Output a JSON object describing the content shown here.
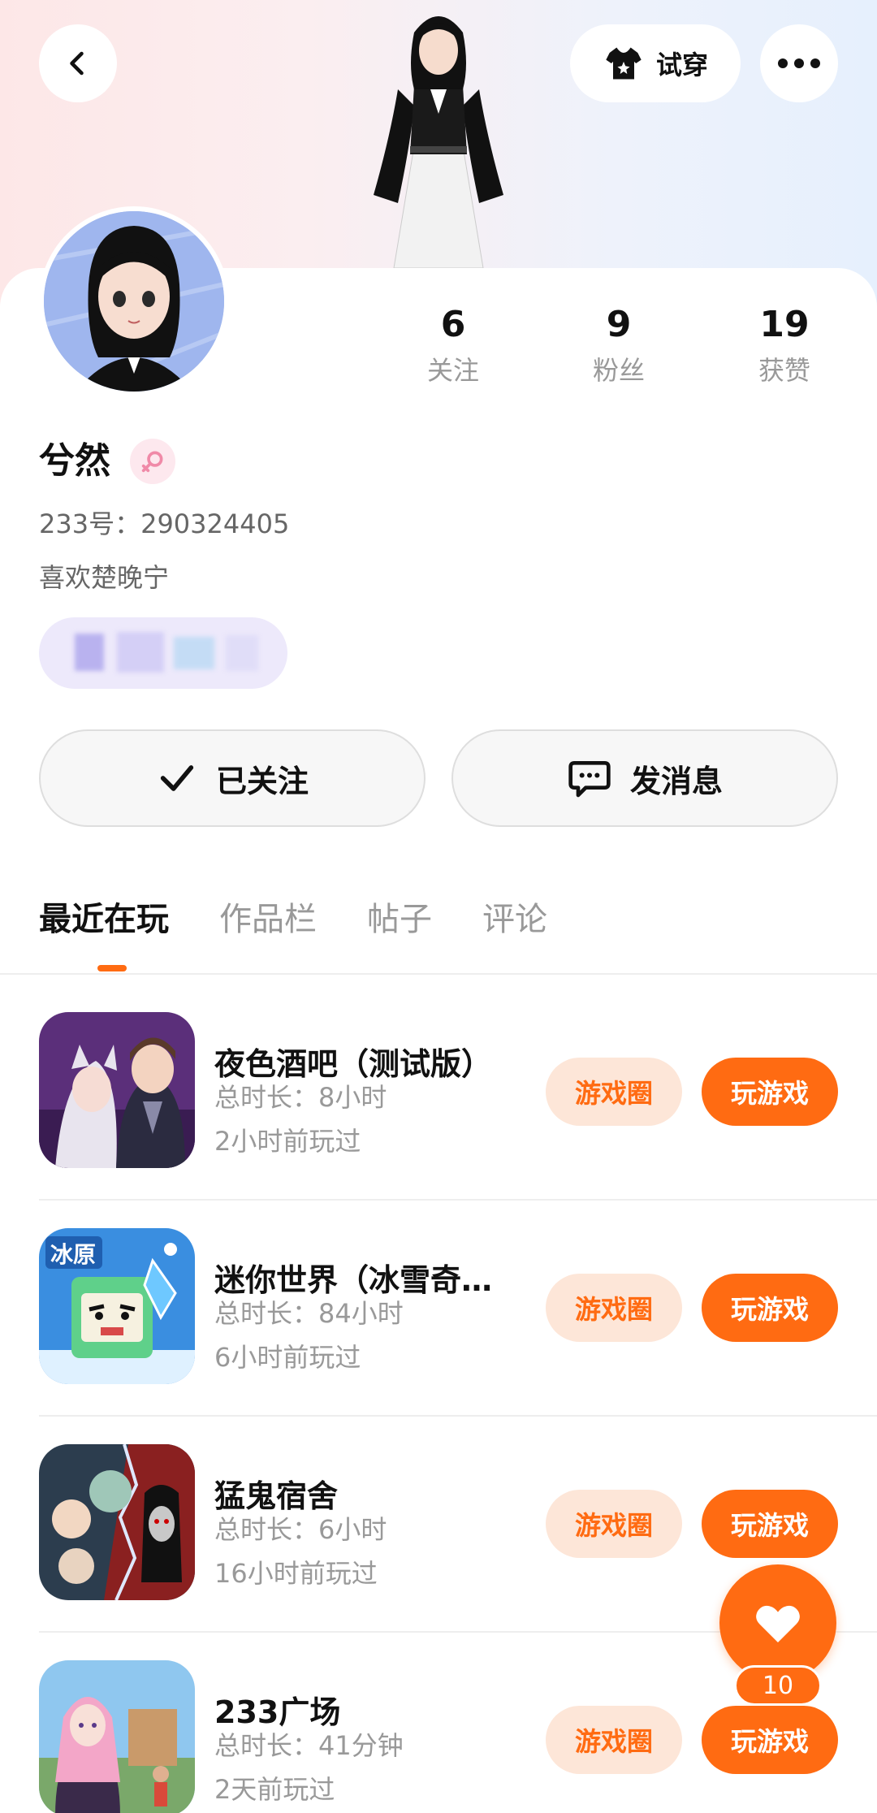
{
  "header": {
    "back_icon": "chevron-left-icon",
    "tryon_label": "试穿",
    "tryon_icon": "shirt-icon",
    "more_icon": "more-dots-icon"
  },
  "profile": {
    "stats": [
      {
        "value": "6",
        "label": "关注"
      },
      {
        "value": "9",
        "label": "粉丝"
      },
      {
        "value": "19",
        "label": "获赞"
      }
    ],
    "name": "兮然",
    "gender_icon": "female-icon",
    "uid": "233号：290324405",
    "bio": "喜欢楚晚宁"
  },
  "actions": {
    "follow_label": "已关注",
    "follow_icon": "check-icon",
    "message_label": "发消息",
    "message_icon": "chat-bubble-icon"
  },
  "tabs": [
    {
      "label": "最近在玩",
      "active": true
    },
    {
      "label": "作品栏",
      "active": false
    },
    {
      "label": "帖子",
      "active": false
    },
    {
      "label": "评论",
      "active": false
    }
  ],
  "games": [
    {
      "title": "夜色酒吧（测试版）",
      "duration": "总时长：8小时",
      "last_played": "2小时前玩过",
      "circle_label": "游戏圈",
      "play_label": "玩游戏"
    },
    {
      "title": "迷你世界（冰雪奇…",
      "duration": "总时长：84小时",
      "last_played": "6小时前玩过",
      "circle_label": "游戏圈",
      "play_label": "玩游戏"
    },
    {
      "title": "猛鬼宿舍",
      "duration": "总时长：6小时",
      "last_played": "16小时前玩过",
      "circle_label": "游戏圈",
      "play_label": "玩游戏"
    },
    {
      "title": "233广场",
      "duration": "总时长：41分钟",
      "last_played": "2天前玩过",
      "circle_label": "游戏圈",
      "play_label": "玩游戏"
    }
  ],
  "like": {
    "icon": "heart-icon",
    "count": "10"
  },
  "colors": {
    "accent": "#ff6b12",
    "accent_light": "#fde6d8"
  }
}
